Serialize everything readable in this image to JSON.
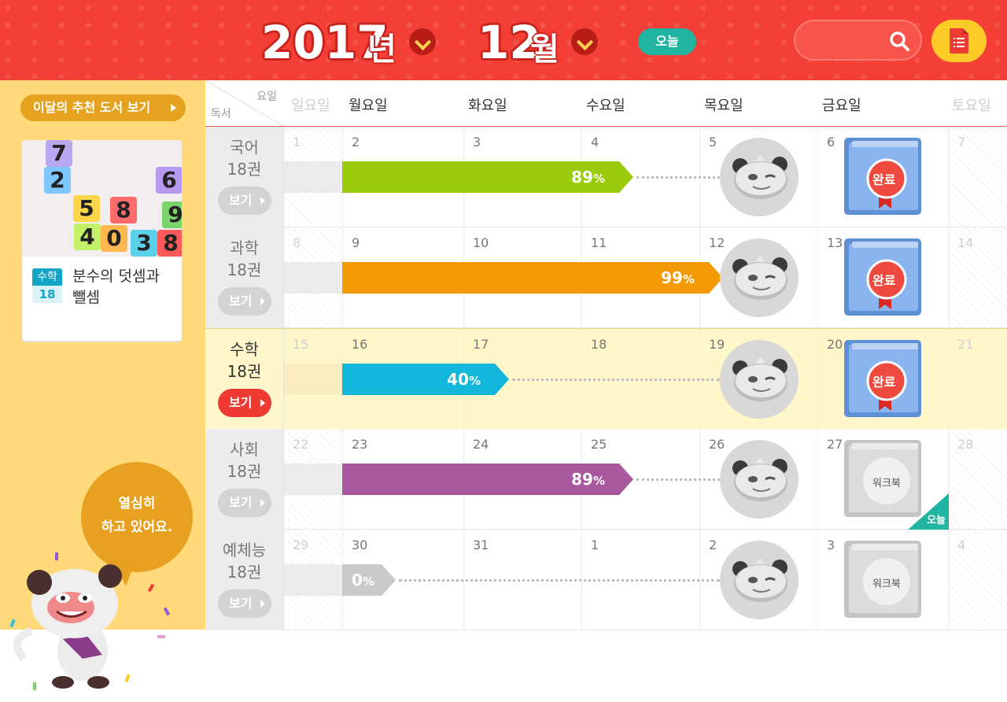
{
  "header": {
    "year": "2017",
    "year_unit": "년",
    "month": "12",
    "month_unit": "월",
    "today_label": "오늘",
    "search": {
      "placeholder": ""
    }
  },
  "sidebar": {
    "recommend_label": "이달의 추천 도서 보기",
    "book": {
      "subject_tag": "수학",
      "count_tag": "18",
      "title": "분수의 덧셈과 뺄셈",
      "cover_blocks": [
        "7",
        "2",
        "6",
        "5",
        "8",
        "9",
        "4",
        "0",
        "3",
        "8"
      ]
    },
    "speech_line1": "열심히",
    "speech_line2": "하고 있어요."
  },
  "calendar": {
    "corner_day": "요일",
    "corner_reading": "독서",
    "days": [
      "일요일",
      "월요일",
      "화요일",
      "수요일",
      "목요일",
      "금요일",
      "토요일"
    ],
    "view_label": "보기",
    "complete_label": "완료",
    "workbook_label": "워크북",
    "today_flag": "오늘",
    "rows": [
      {
        "subject": "국어",
        "count": "18권",
        "dates": [
          "1",
          "2",
          "3",
          "4",
          "5",
          "6",
          "7"
        ],
        "progress": "89",
        "pct_sign": "%",
        "color": "#9acb0a",
        "status": "완료",
        "active": false
      },
      {
        "subject": "과학",
        "count": "18권",
        "dates": [
          "8",
          "9",
          "10",
          "11",
          "12",
          "13",
          "14"
        ],
        "progress": "99",
        "pct_sign": "%",
        "color": "#f49a05",
        "status": "완료",
        "active": false
      },
      {
        "subject": "수학",
        "count": "18권",
        "dates": [
          "15",
          "16",
          "17",
          "18",
          "19",
          "20",
          "21"
        ],
        "progress": "40",
        "pct_sign": "%",
        "color": "#12b7dc",
        "status": "완료",
        "active": true
      },
      {
        "subject": "사회",
        "count": "18권",
        "dates": [
          "22",
          "23",
          "24",
          "25",
          "26",
          "27",
          "28"
        ],
        "progress": "89",
        "pct_sign": "%",
        "color": "#a9579f",
        "status": "워크북",
        "active": false
      },
      {
        "subject": "예체능",
        "count": "18권",
        "dates": [
          "29",
          "30",
          "31",
          "1",
          "2",
          "3",
          "4"
        ],
        "progress": "0",
        "pct_sign": "%",
        "color": "#c9c9c9",
        "status": "워크북",
        "active": false
      }
    ]
  },
  "colors": {
    "header_red": "#f33f36",
    "accent_yellow": "#ffcb26",
    "today_teal": "#1fb5a0",
    "sidebar_bg": "#ffd97a",
    "active_row": "#fff7c9"
  },
  "icons": {
    "search": "search-icon",
    "menu": "list-document-icon",
    "dropdown": "chevron-down-icon",
    "mascot": "panda-mascot-icon",
    "book": "book-icon"
  }
}
